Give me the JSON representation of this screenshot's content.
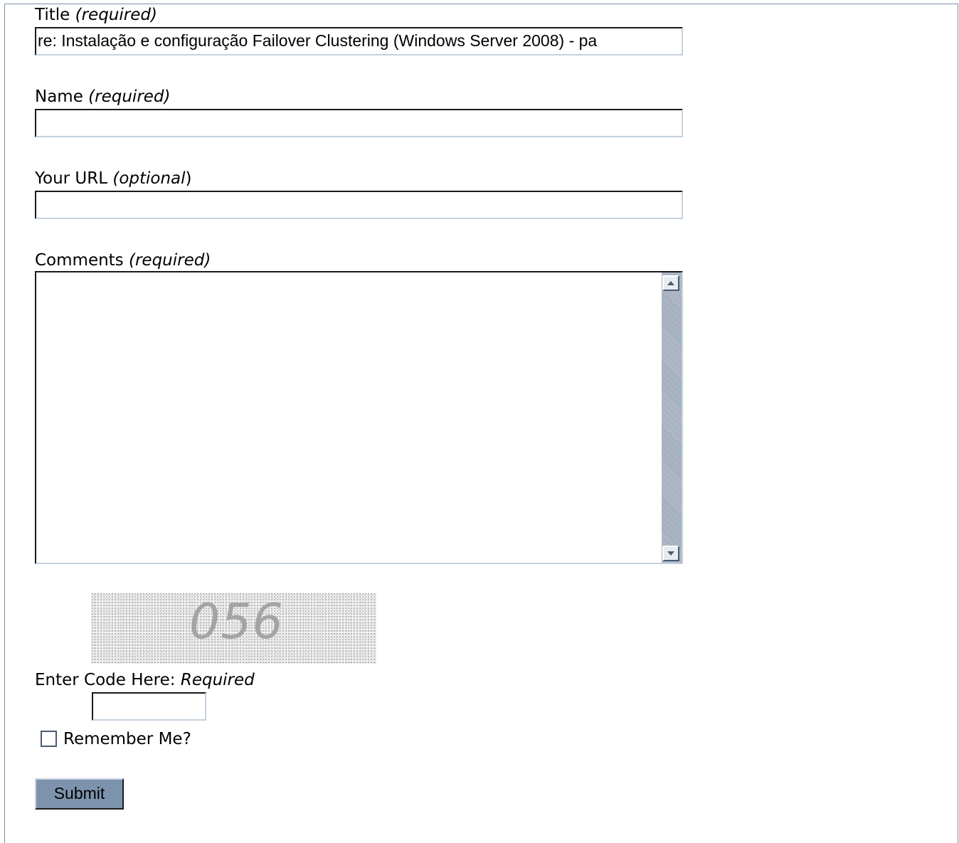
{
  "form": {
    "title_label": "Title",
    "title_req": "(required)",
    "title_value": "re: Instalação e configuração Failover Clustering (Windows Server 2008) - pa",
    "name_label": "Name",
    "name_req": "(required)",
    "name_value": "",
    "url_label": "Your URL",
    "url_opt": "(optional",
    "url_close": ")",
    "url_value": "",
    "comments_label": "Comments",
    "comments_req": "(required)",
    "captcha_text": "056",
    "code_label": "Enter Code Here:",
    "code_req": "Required",
    "remember_label": "Remember Me?",
    "remember_checked": false,
    "submit_label": "Submit"
  },
  "colors": {
    "submit_bg": "#7d93ad",
    "scrollbar": "#9aa8b8",
    "frame_border": "#7f8fa3"
  }
}
